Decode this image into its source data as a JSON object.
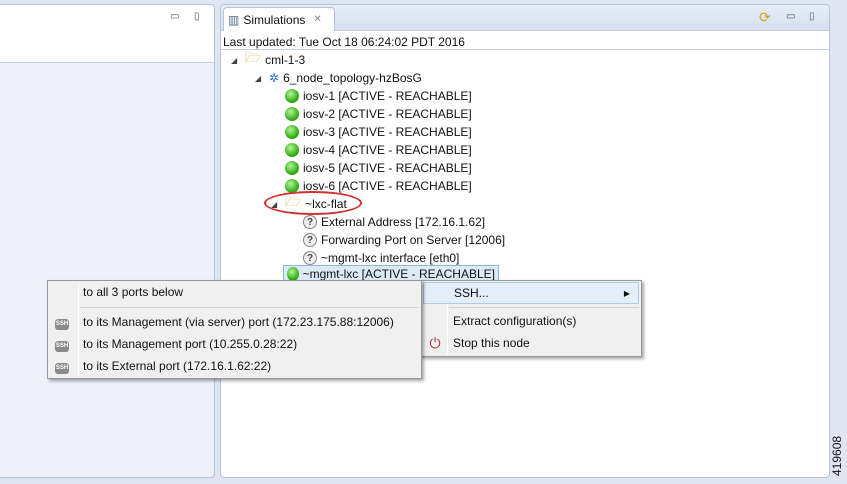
{
  "left_panel": {
    "minimize": "▭",
    "maximize": "▯"
  },
  "simulations": {
    "tab_label": "Simulations",
    "last_updated": "Last updated: Tue Oct 18 06:24:02 PDT 2016",
    "tree": {
      "root": "cml-1-3",
      "topology": "6_node_topology-hzBosG",
      "nodes": [
        "iosv-1  [ACTIVE - REACHABLE]",
        "iosv-2  [ACTIVE - REACHABLE]",
        "iosv-3  [ACTIVE - REACHABLE]",
        "iosv-4  [ACTIVE - REACHABLE]",
        "iosv-5  [ACTIVE - REACHABLE]",
        "iosv-6  [ACTIVE - REACHABLE]"
      ],
      "lxc_folder": "~lxc-flat",
      "lxc_props": [
        "External Address  [172.16.1.62]",
        "Forwarding Port on Server  [12006]",
        "~mgmt-lxc interface  [eth0]"
      ],
      "selected_node": "~mgmt-lxc  [ACTIVE - REACHABLE]"
    }
  },
  "context_menu": {
    "ssh": "SSH...",
    "extract": "Extract configuration(s)",
    "stop": "Stop this node"
  },
  "ssh_submenu": {
    "all": "to all 3 ports below",
    "items": [
      "to its Management (via server) port (172.23.175.88:12006)",
      "to its Management port (10.255.0.28:22)",
      "to its External port (172.16.1.62:22)"
    ],
    "icon_text": "SSH"
  },
  "figure_id": "419608",
  "colors": {
    "highlight": "#d43030",
    "node_green": "#35b21a"
  }
}
